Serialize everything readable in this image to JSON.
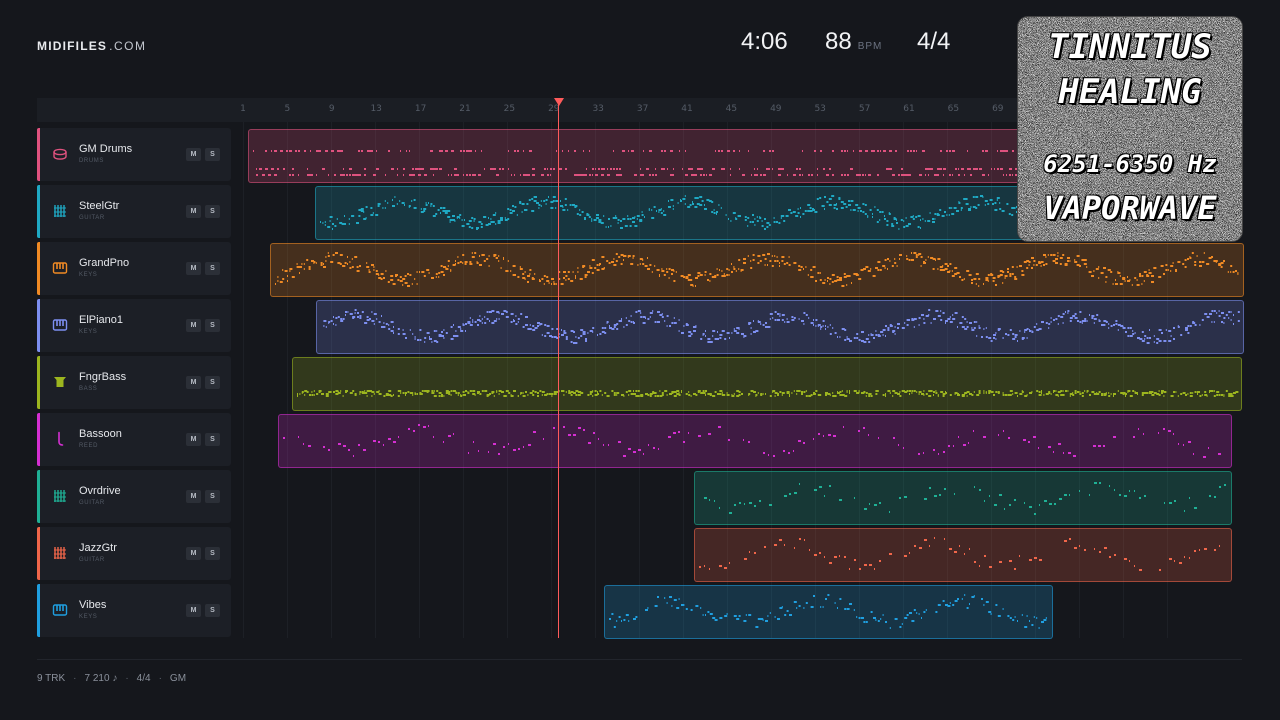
{
  "header": {
    "brand_bold": "MIDIFILES",
    "brand_tld": ".COM",
    "duration": "4:06",
    "tempo": "88",
    "tempo_unit": "BPM",
    "time_signature": "4/4"
  },
  "ruler": {
    "bars": [
      "1",
      "5",
      "9",
      "13",
      "17",
      "21",
      "25",
      "29",
      "33",
      "37",
      "41",
      "45",
      "49",
      "53",
      "57",
      "61",
      "65",
      "69"
    ]
  },
  "tracks": [
    {
      "name": "GM Drums",
      "type": "DRUMS",
      "color": "#e0527f",
      "icon": "drum-icon"
    },
    {
      "name": "SteelGtr",
      "type": "GUITAR",
      "color": "#1fa9c4",
      "icon": "guitar-icon"
    },
    {
      "name": "GrandPno",
      "type": "KEYS",
      "color": "#f08a24",
      "icon": "keys-icon"
    },
    {
      "name": "ElPiano1",
      "type": "KEYS",
      "color": "#7d8ff0",
      "icon": "keys-icon"
    },
    {
      "name": "FngrBass",
      "type": "BASS",
      "color": "#9cb51f",
      "icon": "bass-icon"
    },
    {
      "name": "Bassoon",
      "type": "REED",
      "color": "#d52fd2",
      "icon": "reed-icon"
    },
    {
      "name": "Ovrdrive",
      "type": "GUITAR",
      "color": "#1fb095",
      "icon": "guitar-icon"
    },
    {
      "name": "JazzGtr",
      "type": "GUITAR",
      "color": "#f0664a",
      "icon": "guitar-icon"
    },
    {
      "name": "Vibes",
      "type": "KEYS",
      "color": "#1f9fe0",
      "icon": "keys-icon"
    }
  ],
  "buttons": {
    "mute": "M",
    "solo": "S"
  },
  "footer": {
    "tracks": "9 TRK",
    "notes": "7 210 ♪",
    "signature": "4/4",
    "standard": "GM"
  },
  "thumbnail": {
    "line1": "TINNITUS",
    "line2": "HEALING",
    "line3": "6251-6350 Hz",
    "line4": "VAPORWAVE"
  }
}
